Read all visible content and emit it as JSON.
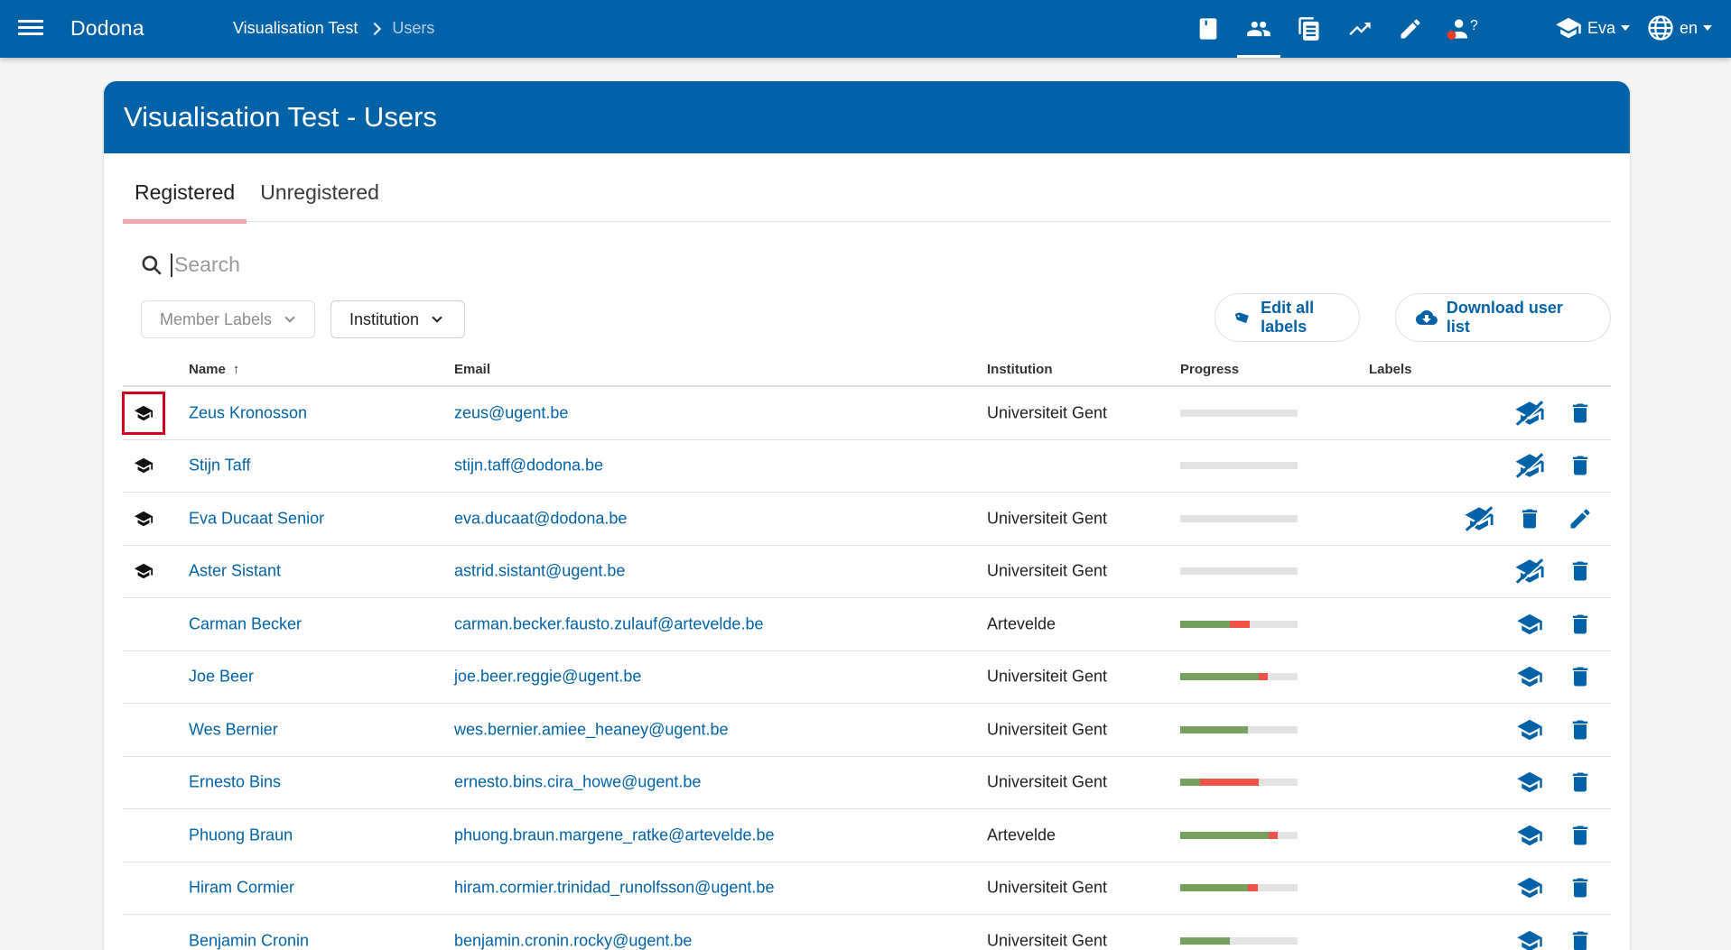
{
  "app": {
    "brand": "Dodona"
  },
  "breadcrumb": {
    "course": "Visualisation Test",
    "current": "Users"
  },
  "nav": {
    "icons": [
      "book-icon",
      "users-icon",
      "document-icon",
      "trend-icon",
      "pencil-icon",
      "help-user-icon"
    ],
    "help_badge": "?",
    "user_name": "Eva",
    "language": "en"
  },
  "page": {
    "title": "Visualisation Test - Users",
    "tabs": [
      {
        "label": "Registered",
        "active": true
      },
      {
        "label": "Unregistered",
        "active": false
      }
    ],
    "search": {
      "placeholder": "Search"
    },
    "filters": {
      "labels": "Member Labels",
      "institution": "Institution"
    },
    "buttons": {
      "edit_labels": "Edit all labels",
      "download": "Download user list"
    }
  },
  "colors": {
    "primary": "#0162a7",
    "progress_correct": "#75a05e",
    "progress_wrong": "#ef5246",
    "progress_track": "#e3e3e3",
    "tab_indicator": "#f2a6ad"
  },
  "table": {
    "headers": {
      "name": "Name",
      "email": "Email",
      "institution": "Institution",
      "progress": "Progress",
      "labels": "Labels"
    },
    "sort_indicator": "↑",
    "rows": [
      {
        "role": "staff",
        "name": "Zeus Kronosson",
        "email": "zeus@ugent.be",
        "institution": "Universiteit Gent",
        "correct": 0,
        "wrong": 0,
        "actions": [
          "unmake-staff",
          "delete"
        ]
      },
      {
        "role": "staff",
        "name": "Stijn Taff",
        "email": "stijn.taff@dodona.be",
        "institution": "",
        "correct": 0,
        "wrong": 0,
        "actions": [
          "unmake-staff",
          "delete"
        ]
      },
      {
        "role": "staff",
        "name": "Eva Ducaat Senior",
        "email": "eva.ducaat@dodona.be",
        "institution": "Universiteit Gent",
        "correct": 0,
        "wrong": 0,
        "actions": [
          "unmake-staff",
          "delete",
          "edit"
        ]
      },
      {
        "role": "staff",
        "name": "Aster Sistant",
        "email": "astrid.sistant@ugent.be",
        "institution": "Universiteit Gent",
        "correct": 0,
        "wrong": 0,
        "actions": [
          "unmake-staff",
          "delete"
        ]
      },
      {
        "role": "student",
        "name": "Carman Becker",
        "email": "carman.becker.fausto.zulauf@artevelde.be",
        "institution": "Artevelde",
        "correct": 0.42,
        "wrong": 0.17,
        "actions": [
          "make-staff",
          "delete"
        ]
      },
      {
        "role": "student",
        "name": "Joe Beer",
        "email": "joe.beer.reggie@ugent.be",
        "institution": "Universiteit Gent",
        "correct": 0.67,
        "wrong": 0.08,
        "actions": [
          "make-staff",
          "delete"
        ]
      },
      {
        "role": "student",
        "name": "Wes Bernier",
        "email": "wes.bernier.amiee_heaney@ugent.be",
        "institution": "Universiteit Gent",
        "correct": 0.58,
        "wrong": 0,
        "actions": [
          "make-staff",
          "delete"
        ]
      },
      {
        "role": "student",
        "name": "Ernesto Bins",
        "email": "ernesto.bins.cira_howe@ugent.be",
        "institution": "Universiteit Gent",
        "correct": 0.17,
        "wrong": 0.5,
        "actions": [
          "make-staff",
          "delete"
        ]
      },
      {
        "role": "student",
        "name": "Phuong Braun",
        "email": "phuong.braun.margene_ratke@artevelde.be",
        "institution": "Artevelde",
        "correct": 0.75,
        "wrong": 0.08,
        "actions": [
          "make-staff",
          "delete"
        ]
      },
      {
        "role": "student",
        "name": "Hiram Cormier",
        "email": "hiram.cormier.trinidad_runolfsson@ugent.be",
        "institution": "Universiteit Gent",
        "correct": 0.58,
        "wrong": 0.08,
        "actions": [
          "make-staff",
          "delete"
        ]
      },
      {
        "role": "student",
        "name": "Benjamin Cronin",
        "email": "benjamin.cronin.rocky@ugent.be",
        "institution": "Universiteit Gent",
        "correct": 0.42,
        "wrong": 0,
        "actions": [
          "make-staff",
          "delete"
        ]
      }
    ]
  }
}
